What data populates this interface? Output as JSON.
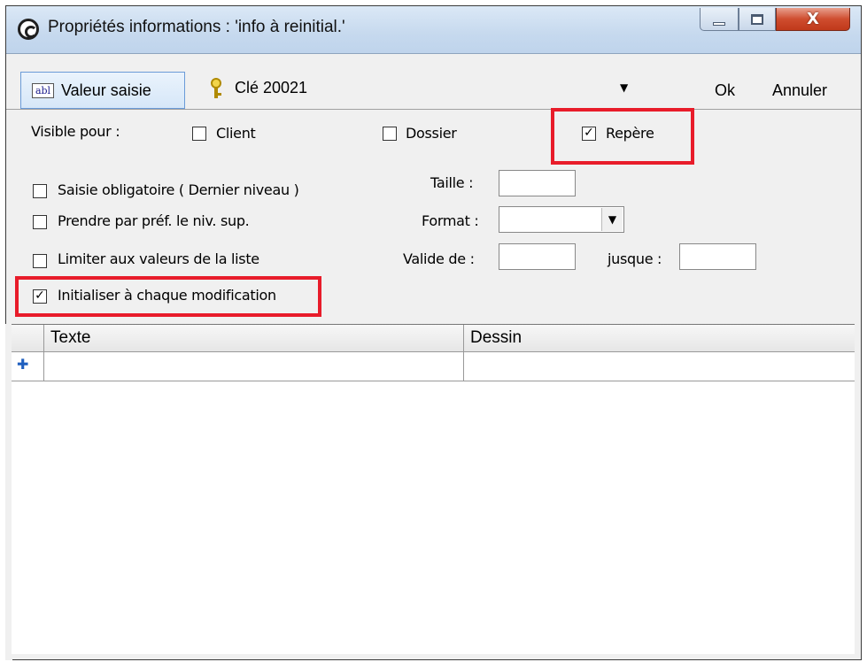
{
  "window": {
    "title": "Propriétés informations : 'info à reinitial.'",
    "close_label": "X"
  },
  "toolbar": {
    "valeur_saisie_label": "Valeur saisie",
    "abl_icon_text": "abl",
    "key_value": "Clé 20021",
    "ok_label": "Ok",
    "cancel_label": "Annuler"
  },
  "options": {
    "visible_pour_label": "Visible pour :",
    "visible_client": {
      "label": "Client",
      "checked": false
    },
    "visible_dossier": {
      "label": "Dossier",
      "checked": false
    },
    "visible_repere": {
      "label": "Repère",
      "checked": true
    },
    "saisie_obligatoire": {
      "label": "Saisie obligatoire ( Dernier niveau )",
      "checked": false
    },
    "prendre_pref": {
      "label": "Prendre par préf. le niv. sup.",
      "checked": false
    },
    "limiter_valeurs": {
      "label": "Limiter aux valeurs de la liste",
      "checked": false
    },
    "initialiser": {
      "label": "Initialiser à chaque modification",
      "checked": true
    },
    "taille_label": "Taille :",
    "taille_value": "",
    "format_label": "Format :",
    "format_value": "",
    "valide_de_label": "Valide de :",
    "valide_de_value": "",
    "jusque_label": "jusque :",
    "jusque_value": ""
  },
  "grid": {
    "columns": [
      "Texte",
      "Dessin"
    ],
    "rows": []
  },
  "colors": {
    "highlight": "#e81c2a",
    "titlebar": "#c6d9ee",
    "close_button": "#c0391a"
  }
}
